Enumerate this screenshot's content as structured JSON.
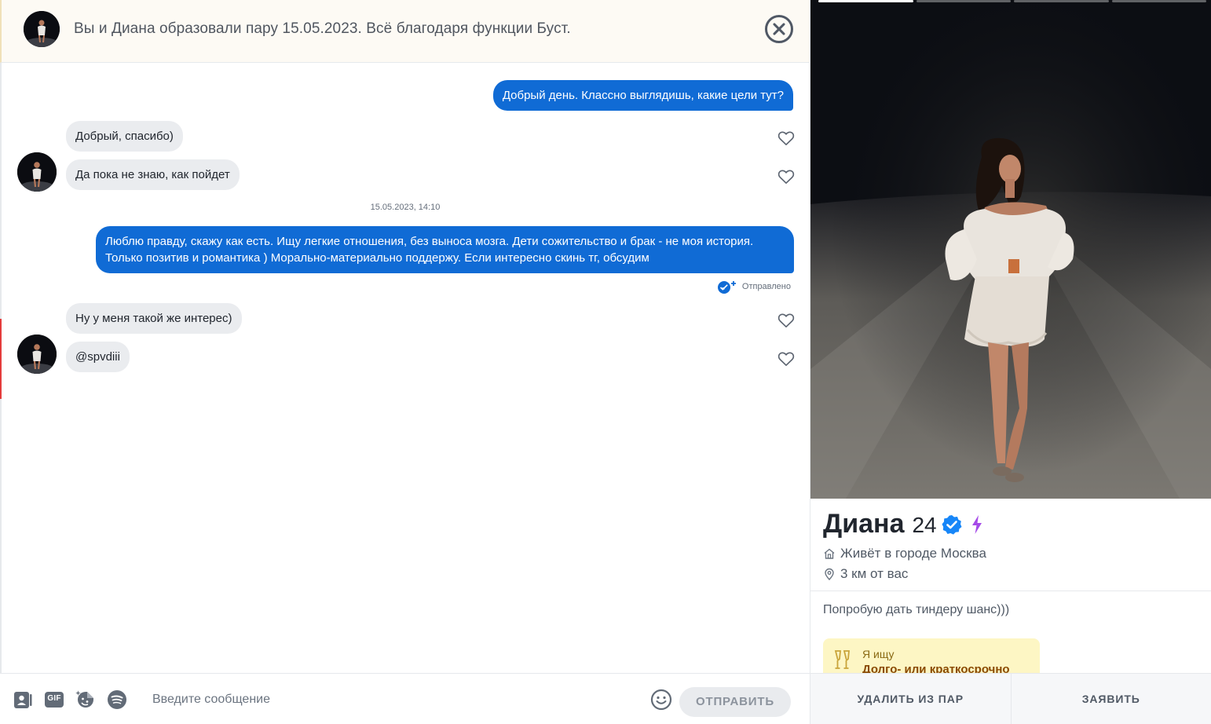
{
  "match_banner": {
    "text": "Вы и Диана образовали пару 15.05.2023. Всё благодаря функции Буст."
  },
  "messages": [
    {
      "direction": "out",
      "text": "Добрый день. Классно выглядишь, какие цели тут?"
    },
    {
      "direction": "in",
      "text": "Добрый, спасибо)"
    },
    {
      "direction": "in",
      "text": "Да пока не знаю, как пойдет"
    },
    {
      "direction": "out",
      "text": "Люблю правду, скажу как есть. Ищу легкие отношения, без выноса мозга. Дети сожительство и брак - не моя история. Только позитив и романтика ) Морально-материально поддержу. Если интересно скинь тг, обсудим"
    },
    {
      "direction": "in",
      "text": "Ну у меня такой же интерес)"
    },
    {
      "direction": "in",
      "text": "@spvdiii"
    }
  ],
  "timestamp": "15.05.2023, 14:10",
  "sent_status": "Отправлено",
  "composer": {
    "placeholder": "Введите сообщение",
    "send_label": "ОТПРАВИТЬ",
    "icons": [
      "contact-card-icon",
      "gif-icon",
      "sticker-icon",
      "spotify-icon",
      "emoji-icon"
    ],
    "gif_label": "GIF"
  },
  "profile": {
    "name": "Диана",
    "age": "24",
    "city": "Живёт в городе Москва",
    "distance": "3 км от вас",
    "bio": "Попробую дать тиндеру шанс)))",
    "looking_for_label": "Я ищу",
    "looking_for_value": "Долго- или краткосрочно",
    "photo_count": 4,
    "active_photo": 1
  },
  "actions": {
    "unmatch": "УДАЛИТЬ ИЗ ПАР",
    "report": "ЗАЯВИТЬ"
  },
  "colors": {
    "outgoing_bubble": "#106bd5",
    "incoming_bubble": "#eaecef",
    "verified": "#1786f8",
    "boost": "#a54ae8"
  }
}
